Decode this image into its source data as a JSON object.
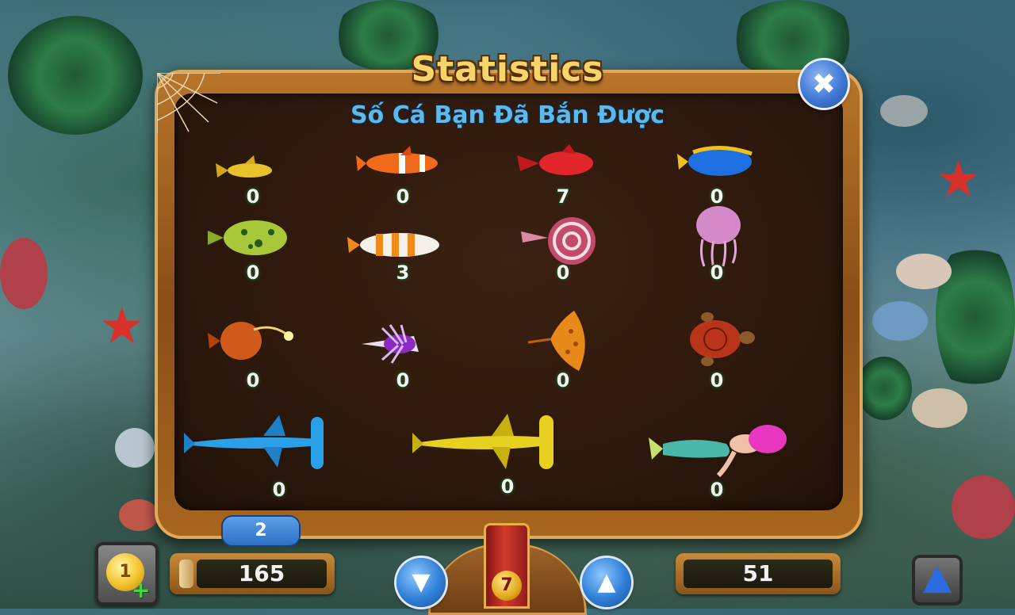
{
  "dialog": {
    "title": "Statistics",
    "subtitle": "Số Cá Bạn Đã Bắn Được",
    "close_label": "✖"
  },
  "fish_stats": [
    {
      "name": "yellow-fish",
      "count": "0"
    },
    {
      "name": "clownfish",
      "count": "0"
    },
    {
      "name": "red-fish",
      "count": "7"
    },
    {
      "name": "blue-tang",
      "count": "0"
    },
    {
      "name": "pufferfish",
      "count": "0"
    },
    {
      "name": "striped-fish",
      "count": "3"
    },
    {
      "name": "nautilus",
      "count": "0"
    },
    {
      "name": "jellyfish",
      "count": "0"
    },
    {
      "name": "anglerfish",
      "count": "0"
    },
    {
      "name": "lionfish",
      "count": "0"
    },
    {
      "name": "stingray",
      "count": "0"
    },
    {
      "name": "sea-turtle",
      "count": "0"
    },
    {
      "name": "blue-hammerhead",
      "count": "0"
    },
    {
      "name": "gold-hammerhead",
      "count": "0"
    },
    {
      "name": "mermaid",
      "count": "0"
    }
  ],
  "hud": {
    "level": "2",
    "coin_button_label": "1",
    "coins": "165",
    "bet_level": "7",
    "right_value": "51"
  },
  "colors": {
    "panel_border": "#8a4e16",
    "panel_inner": "#2a170b",
    "title": "#f6d56a",
    "subtitle": "#5fb8ea",
    "button_blue": "#2f7fd8"
  },
  "icons": {
    "close": "close-icon",
    "arrow_down": "arrow-down-icon",
    "arrow_up": "arrow-up-icon",
    "coin": "coin-icon",
    "boost": "triangle-icon"
  }
}
